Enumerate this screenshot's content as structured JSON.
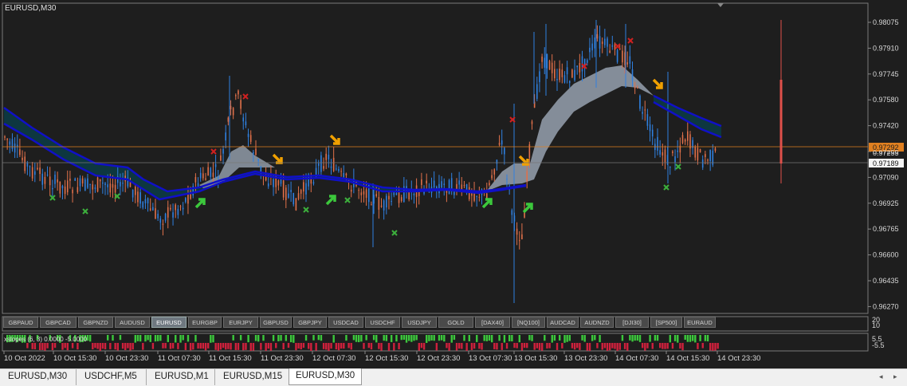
{
  "chart": {
    "title": "EURUSD,M30",
    "bid_price": "0.97292",
    "ask_price": "0.97189",
    "overlap_price": "0.97255",
    "price_ticks": [
      "0.98075",
      "0.97910",
      "0.97745",
      "0.97580",
      "0.97420",
      "0.97255",
      "0.97090",
      "0.96925",
      "0.96765",
      "0.96600",
      "0.96435",
      "0.96270"
    ],
    "time_ticks": [
      "10 Oct 2022",
      "10 Oct 15:30",
      "10 Oct 23:30",
      "11 Oct 07:30",
      "11 Oct 15:30",
      "11 Oct 23:30",
      "12 Oct 07:30",
      "12 Oct 15:30",
      "12 Oct 23:30",
      "13 Oct 07:30",
      "13 Oct 15:30",
      "13 Oct 23:30",
      "14 Oct 07:30",
      "14 Oct 15:30",
      "14 Oct 23:30"
    ],
    "colors": {
      "bull": "#2f80e0",
      "bear": "#e0704a",
      "ma": "#1010c8",
      "ribbon": "#8a94a0",
      "cloud": "#0b3a44",
      "buy_arrow": "#3cc83c",
      "sell_arrow": "#f0a000",
      "exit_x_green": "#3cb03c",
      "exit_x_red": "#d02020",
      "bid_line": "#e08020"
    }
  },
  "symbols": [
    "GBPAUD",
    "GBPCAD",
    "GBPNZD",
    "AUDUSD",
    "EURUSD",
    "EURGBP",
    "EURJPY",
    "GBPUSD",
    "GBPJPY",
    "USDCAD",
    "USDCHF",
    "USDJPY",
    "GOLD",
    "[DAX40]",
    "[NQ100]",
    "AUDCAD",
    "AUDNZD",
    "[DJI30]",
    "[SP500]",
    "EURAUD"
  ],
  "active_symbol": "EURUSD",
  "indicator": {
    "label": "xslopes (6, 3) 0.0000 -5.0000",
    "scale_top": "20",
    "scale_mid": "5.5",
    "scale_bottom": "-5.5",
    "scale_top2": "10"
  },
  "tabs": [
    "EURUSD,M30",
    "USDCHF,M5",
    "EURUSD,M1",
    "EURUSD,M15",
    "EURUSD,M30"
  ],
  "active_tab": 4,
  "scroll": {
    "left": "◂",
    "right": "▸"
  }
}
